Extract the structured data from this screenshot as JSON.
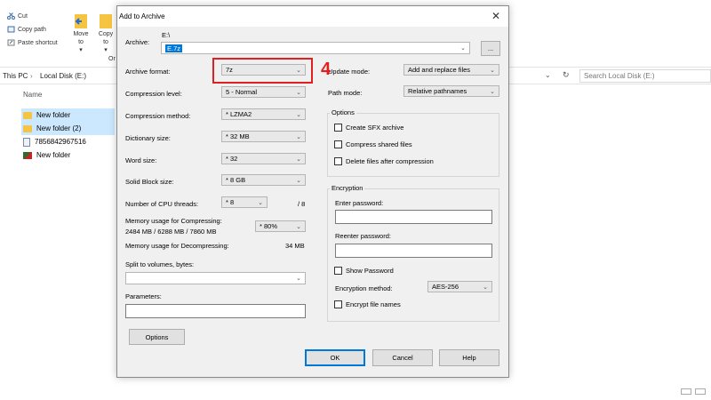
{
  "explorer": {
    "ribbon": {
      "cut": "Cut",
      "copy_path": "Copy path",
      "paste_shortcut": "Paste shortcut",
      "move_to": "Move to",
      "copy_to": "Copy to",
      "move_to_arrow": "▾",
      "copy_to_arrow": "▾",
      "group_label": "Or"
    },
    "address": {
      "this_pc": "This PC",
      "sep": "›",
      "drive": "Local Disk (E:)"
    },
    "search_placeholder": "Search Local Disk (E:)",
    "column_name": "Name",
    "files": [
      {
        "name": "New folder",
        "type": "folder"
      },
      {
        "name": "New folder (2)",
        "type": "folder"
      },
      {
        "name": "7856842967516",
        "type": "doc"
      },
      {
        "name": "New folder",
        "type": "image"
      }
    ]
  },
  "dialog": {
    "title": "Add to Archive",
    "archive_label": "Archive:",
    "archive_path": "E:\\",
    "archive_name": "E.7z",
    "browse_label": "...",
    "left": {
      "archive_format": {
        "label": "Archive format:",
        "value": "7z"
      },
      "compression_level": {
        "label": "Compression level:",
        "value": "5 - Normal"
      },
      "compression_method": {
        "label": "Compression method:",
        "value": "* LZMA2"
      },
      "dictionary_size": {
        "label": "Dictionary size:",
        "value": "* 32 MB"
      },
      "word_size": {
        "label": "Word size:",
        "value": "* 32"
      },
      "solid_block_size": {
        "label": "Solid Block size:",
        "value": "* 8 GB"
      },
      "cpu_threads": {
        "label": "Number of CPU threads:",
        "value": "* 8",
        "max": "/ 8"
      },
      "mem_compress": {
        "label": "Memory usage for Compressing:",
        "detail": "2484 MB / 6288 MB / 7860 MB",
        "value": "* 80%"
      },
      "mem_decompress": {
        "label": "Memory usage for Decompressing:",
        "value": "34 MB"
      },
      "split_label": "Split to volumes, bytes:",
      "split_value": "",
      "parameters_label": "Parameters:",
      "parameters_value": "",
      "options_button": "Options"
    },
    "right": {
      "update_mode": {
        "label": "Update mode:",
        "value": "Add and replace files"
      },
      "path_mode": {
        "label": "Path mode:",
        "value": "Relative pathnames"
      },
      "options_group": "Options",
      "create_sfx": "Create SFX archive",
      "compress_shared": "Compress shared files",
      "delete_after": "Delete files after compression",
      "encryption_group": "Encryption",
      "enter_password": "Enter password:",
      "reenter_password": "Reenter password:",
      "show_password": "Show Password",
      "encryption_method": {
        "label": "Encryption method:",
        "value": "AES-256"
      },
      "encrypt_names": "Encrypt file names"
    },
    "buttons": {
      "ok": "OK",
      "cancel": "Cancel",
      "help": "Help"
    }
  },
  "annotation": {
    "step_number": "4",
    "color": "#e02020"
  }
}
